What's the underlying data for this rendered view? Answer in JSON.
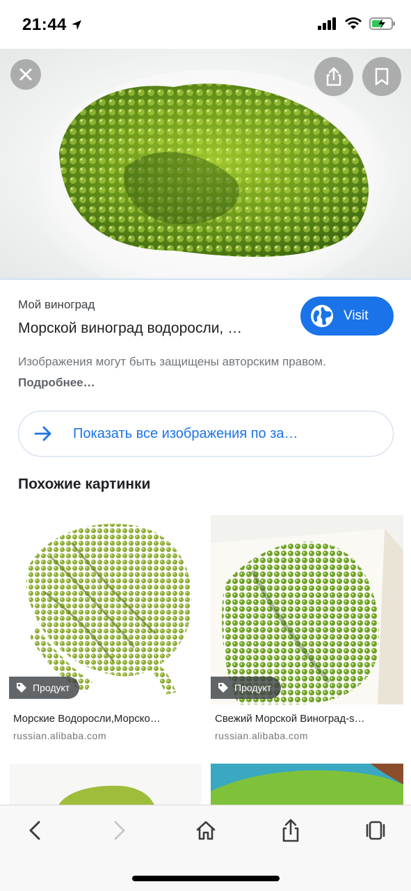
{
  "status_bar": {
    "time": "21:44"
  },
  "result": {
    "site_name": "Мой виноград",
    "title": "Морской виноград водоросли, …",
    "visit_label": "Visit",
    "copyright_text": "Изображения могут быть защищены авторским правом.",
    "learn_more": "Подробнее…"
  },
  "show_all_label": "Показать все изображения по за…",
  "similar": {
    "title": "Похожие картинки",
    "items": [
      {
        "badge": "Продукт",
        "title": "Морские Водоросли,Морско…",
        "source": "russian.alibaba.com"
      },
      {
        "badge": "Продукт",
        "title": "Свежий Морской Виноград-s…",
        "source": "russian.alibaba.com"
      }
    ]
  },
  "colors": {
    "accent": "#1a73e8",
    "seaweed": "#6f9a1c"
  },
  "icons": {
    "close": "close-icon",
    "share": "share-icon",
    "bookmark": "bookmark-icon",
    "globe": "globe-icon",
    "arrow": "arrow-right-icon",
    "tag": "tag-icon",
    "back": "chevron-left-icon",
    "forward": "chevron-right-icon",
    "home": "home-icon",
    "tabs": "tabs-icon"
  }
}
